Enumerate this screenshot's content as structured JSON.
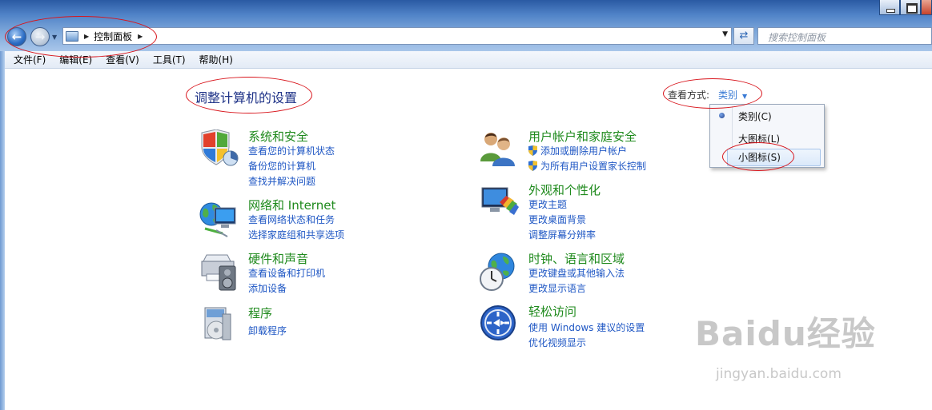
{
  "window": {
    "controls": [
      "minimize",
      "maximize",
      "close"
    ]
  },
  "nav": {
    "breadcrumb": "控制面板",
    "search_placeholder": "搜索控制面板"
  },
  "menu": [
    "文件(F)",
    "编辑(E)",
    "查看(V)",
    "工具(T)",
    "帮助(H)"
  ],
  "content": {
    "title": "调整计算机的设置",
    "view_label": "查看方式:",
    "view_value": "类别",
    "dropdown_options": [
      {
        "label": "类别(C)",
        "selected": true
      },
      {
        "label": "大图标(L)",
        "selected": false
      },
      {
        "label": "小图标(S)",
        "selected": false,
        "highlighted": true
      }
    ]
  },
  "categories": [
    {
      "title": "系统和安全",
      "icon": "system-security-icon",
      "links": [
        "查看您的计算机状态",
        "备份您的计算机",
        "查找并解决问题"
      ]
    },
    {
      "title": "网络和 Internet",
      "icon": "network-internet-icon",
      "links": [
        "查看网络状态和任务",
        "选择家庭组和共享选项"
      ]
    },
    {
      "title": "硬件和声音",
      "icon": "hardware-sound-icon",
      "links": [
        "查看设备和打印机",
        "添加设备"
      ]
    },
    {
      "title": "程序",
      "icon": "programs-icon",
      "links": [
        "卸载程序"
      ]
    },
    {
      "title": "用户帐户和家庭安全",
      "icon": "user-accounts-icon",
      "links": [
        "添加或删除用户帐户",
        "为所有用户设置家长控制"
      ]
    },
    {
      "title": "外观和个性化",
      "icon": "appearance-icon",
      "links": [
        "更改主题",
        "更改桌面背景",
        "调整屏幕分辨率"
      ]
    },
    {
      "title": "时钟、语言和区域",
      "icon": "clock-language-icon",
      "links": [
        "更改键盘或其他输入法",
        "更改显示语言"
      ]
    },
    {
      "title": "轻松访问",
      "icon": "ease-of-access-icon",
      "links": [
        "使用 Windows 建议的设置",
        "优化视频显示"
      ]
    }
  ],
  "watermark": {
    "main": "Baidu经验",
    "sub": "jingyan.baidu.com"
  },
  "colors": {
    "category_title": "#1f8a1d",
    "link": "#1f57c4",
    "page_title": "#1e3287",
    "annotation": "#d8141b"
  }
}
